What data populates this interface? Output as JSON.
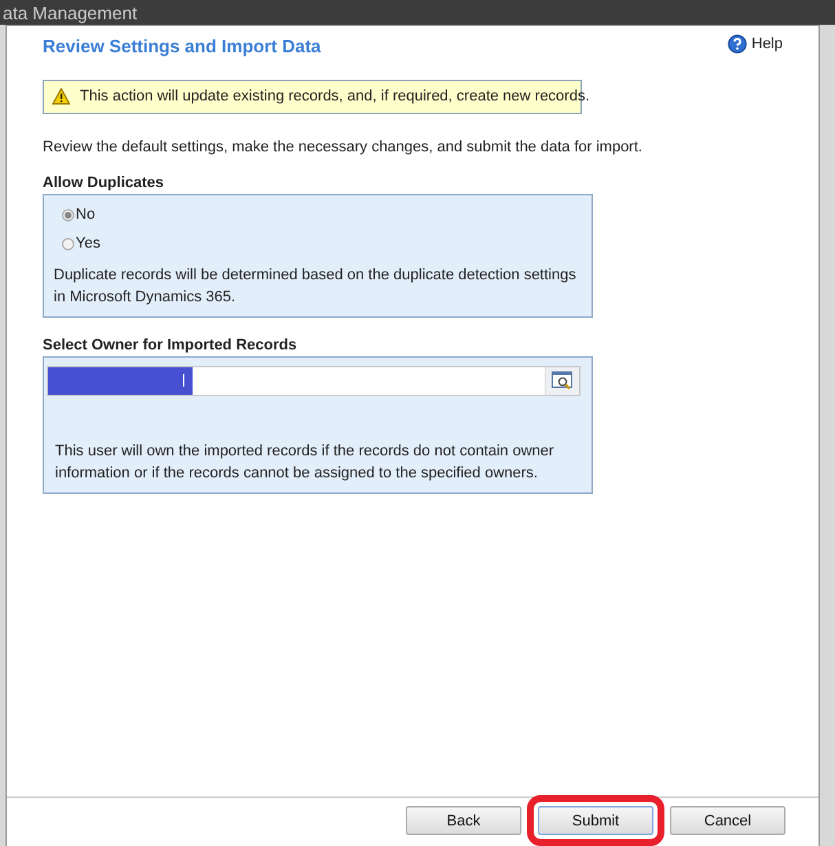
{
  "background_window": {
    "title": "ata Management"
  },
  "dialog": {
    "title": "Review Settings and Import Data",
    "help_link": "Help",
    "warning": "This action will update existing records, and, if required, create new records.",
    "instructions": "Review the default settings, make the necessary changes, and submit the data for import.",
    "allow_duplicates": {
      "label": "Allow Duplicates",
      "options": [
        {
          "label": "No",
          "selected": true
        },
        {
          "label": "Yes",
          "selected": false
        }
      ],
      "note": "Duplicate records will be determined based on the duplicate detection settings in Microsoft Dynamics 365."
    },
    "owner": {
      "label": "Select Owner for Imported Records",
      "value_redacted": true,
      "note": "This user will own the imported records if the records do not contain owner information or if the records cannot be assigned to the specified owners."
    },
    "buttons": [
      {
        "label": "Back",
        "highlighted": false
      },
      {
        "label": "Submit",
        "highlighted": true
      },
      {
        "label": "Cancel",
        "highlighted": false
      }
    ]
  }
}
